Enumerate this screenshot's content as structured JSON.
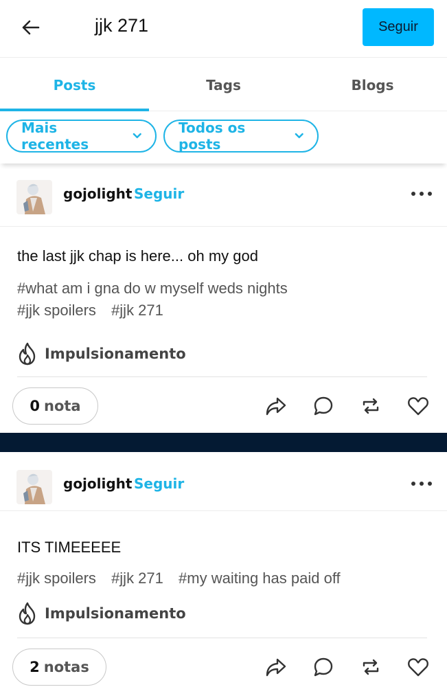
{
  "header": {
    "back_icon": "arrow-left-icon",
    "search_query": "jjk 271",
    "follow_label": "Seguir",
    "accent_color": "#00b8ff"
  },
  "tabs": [
    {
      "label": "Posts",
      "active": true
    },
    {
      "label": "Tags",
      "active": false
    },
    {
      "label": "Blogs",
      "active": false
    }
  ],
  "filters": {
    "sort_label": "Mais recentes",
    "type_label": "Todos os posts"
  },
  "posts": [
    {
      "username": "gojolight",
      "follow_label": "Seguir",
      "text": "the last jjk chap is here... oh my god",
      "tags": [
        "#what am i gna do w myself weds nights",
        "#jjk spoilers",
        "#jjk 271"
      ],
      "boost_label": "Impulsionamento",
      "notes_count": "0",
      "notes_label": "nota"
    },
    {
      "username": "gojolight",
      "follow_label": "Seguir",
      "text": "ITS TIMEEEEE",
      "tags": [
        "#jjk spoilers",
        "#jjk 271",
        "#my waiting has paid off"
      ],
      "boost_label": "Impulsionamento",
      "notes_count": "2",
      "notes_label": "notas"
    }
  ],
  "colors": {
    "accent": "#1eb4e6",
    "divider": "#041a33"
  }
}
